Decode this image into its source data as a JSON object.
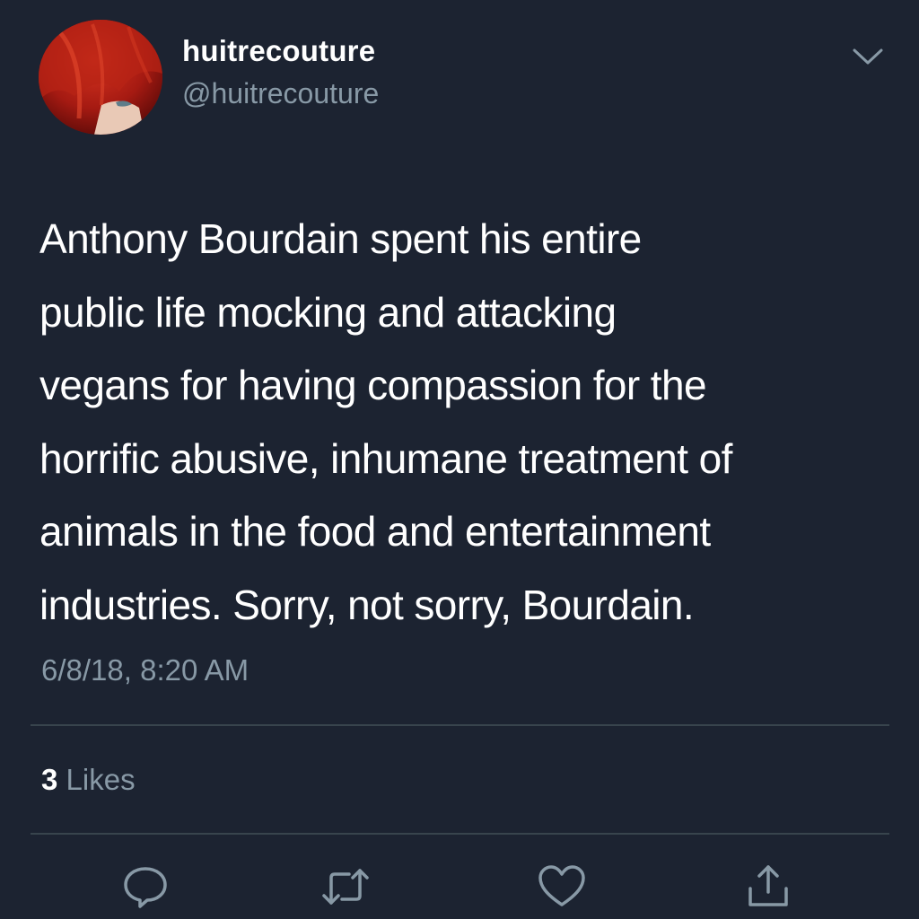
{
  "tweet": {
    "display_name": "huitrecouture",
    "handle": "@huitrecouture",
    "text_lines": [
      "Anthony Bourdain spent his entire",
      "public life mocking and attacking",
      "vegans for having compassion for the",
      "horrific abusive, inhumane treatment of",
      "animals in the food and entertainment",
      "industries. Sorry, not sorry, Bourdain."
    ],
    "timestamp": "6/8/18, 8:20 AM",
    "likes_count": "3",
    "likes_label": " Likes"
  },
  "icons": {
    "menu": "chevron-down-icon",
    "reply": "reply-icon",
    "retweet": "retweet-icon",
    "like": "heart-icon",
    "share": "share-icon"
  },
  "colors": {
    "background": "#1c2331",
    "text": "#ffffff",
    "secondary_text": "#8899a6",
    "divider": "#38444d"
  }
}
